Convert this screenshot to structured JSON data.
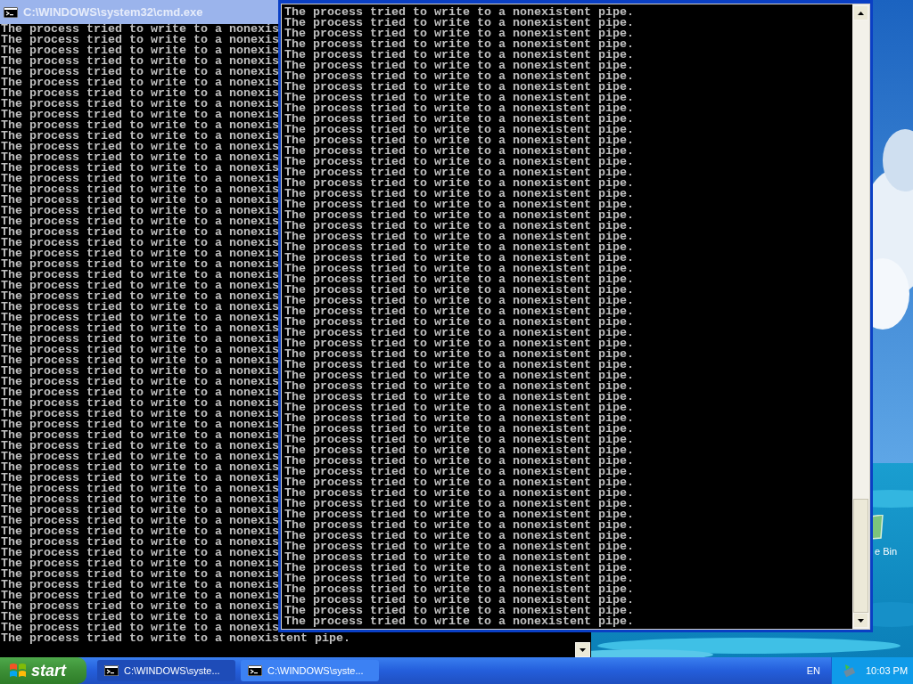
{
  "back_window": {
    "title": "C:\\WINDOWS\\system32\\cmd.exe",
    "lines": [
      "The process tried to write to a nonexis",
      "The process tried to write to a nonexis",
      "The process tried to write to a nonexis",
      "The process tried to write to a nonexis",
      "The process tried to write to a nonexis",
      "The process tried to write to a nonexis",
      "The process tried to write to a nonexis",
      "The process tried to write to a nonexis",
      "The process tried to write to a nonexis",
      "The process tried to write to a nonexis",
      "The process tried to write to a nonexis",
      "The process tried to write to a nonexis",
      "The process tried to write to a nonexis",
      "The process tried to write to a nonexis",
      "The process tried to write to a nonexis",
      "The process tried to write to a nonexis",
      "The process tried to write to a nonexis",
      "The process tried to write to a nonexis",
      "The process tried to write to a nonexis",
      "The process tried to write to a nonexis",
      "The process tried to write to a nonexis",
      "The process tried to write to a nonexis",
      "The process tried to write to a nonexis",
      "The process tried to write to a nonexis",
      "The process tried to write to a nonexis",
      "The process tried to write to a nonexis",
      "The process tried to write to a nonexis",
      "The process tried to write to a nonexis",
      "The process tried to write to a nonexis",
      "The process tried to write to a nonexis",
      "The process tried to write to a nonexis",
      "The process tried to write to a nonexis",
      "The process tried to write to a nonexis",
      "The process tried to write to a nonexis",
      "The process tried to write to a nonexis",
      "The process tried to write to a nonexis",
      "The process tried to write to a nonexis",
      "The process tried to write to a nonexis",
      "The process tried to write to a nonexis",
      "The process tried to write to a nonexis",
      "The process tried to write to a nonexis",
      "The process tried to write to a nonexis",
      "The process tried to write to a nonexis",
      "The process tried to write to a nonexis",
      "The process tried to write to a nonexis",
      "The process tried to write to a nonexis",
      "The process tried to write to a nonexis",
      "The process tried to write to a nonexis",
      "The process tried to write to a nonexis",
      "The process tried to write to a nonexis",
      "The process tried to write to a nonexis",
      "The process tried to write to a nonexis",
      "The process tried to write to a nonexis",
      "The process tried to write to a nonexis",
      "The process tried to write to a nonexis",
      "The process tried to write to a nonexis",
      "The process tried to write to a nonexis",
      "The process tried to write to a nonexistent pipe."
    ]
  },
  "front_window": {
    "lines": [
      "The process tried to write to a nonexistent pipe.",
      "The process tried to write to a nonexistent pipe.",
      "The process tried to write to a nonexistent pipe.",
      "The process tried to write to a nonexistent pipe.",
      "The process tried to write to a nonexistent pipe.",
      "The process tried to write to a nonexistent pipe.",
      "The process tried to write to a nonexistent pipe.",
      "The process tried to write to a nonexistent pipe.",
      "The process tried to write to a nonexistent pipe.",
      "The process tried to write to a nonexistent pipe.",
      "The process tried to write to a nonexistent pipe.",
      "The process tried to write to a nonexistent pipe.",
      "The process tried to write to a nonexistent pipe.",
      "The process tried to write to a nonexistent pipe.",
      "The process tried to write to a nonexistent pipe.",
      "The process tried to write to a nonexistent pipe.",
      "The process tried to write to a nonexistent pipe.",
      "The process tried to write to a nonexistent pipe.",
      "The process tried to write to a nonexistent pipe.",
      "The process tried to write to a nonexistent pipe.",
      "The process tried to write to a nonexistent pipe.",
      "The process tried to write to a nonexistent pipe.",
      "The process tried to write to a nonexistent pipe.",
      "The process tried to write to a nonexistent pipe.",
      "The process tried to write to a nonexistent pipe.",
      "The process tried to write to a nonexistent pipe.",
      "The process tried to write to a nonexistent pipe.",
      "The process tried to write to a nonexistent pipe.",
      "The process tried to write to a nonexistent pipe.",
      "The process tried to write to a nonexistent pipe.",
      "The process tried to write to a nonexistent pipe.",
      "The process tried to write to a nonexistent pipe.",
      "The process tried to write to a nonexistent pipe.",
      "The process tried to write to a nonexistent pipe.",
      "The process tried to write to a nonexistent pipe.",
      "The process tried to write to a nonexistent pipe.",
      "The process tried to write to a nonexistent pipe.",
      "The process tried to write to a nonexistent pipe.",
      "The process tried to write to a nonexistent pipe.",
      "The process tried to write to a nonexistent pipe.",
      "The process tried to write to a nonexistent pipe.",
      "The process tried to write to a nonexistent pipe.",
      "The process tried to write to a nonexistent pipe.",
      "The process tried to write to a nonexistent pipe.",
      "The process tried to write to a nonexistent pipe.",
      "The process tried to write to a nonexistent pipe.",
      "The process tried to write to a nonexistent pipe.",
      "The process tried to write to a nonexistent pipe.",
      "The process tried to write to a nonexistent pipe.",
      "The process tried to write to a nonexistent pipe.",
      "The process tried to write to a nonexistent pipe.",
      "The process tried to write to a nonexistent pipe.",
      "The process tried to write to a nonexistent pipe.",
      "The process tried to write to a nonexistent pipe.",
      "The process tried to write to a nonexistent pipe.",
      "The process tried to write to a nonexistent pipe.",
      "The process tried to write to a nonexistent pipe.",
      "The process tried to write to a nonexistent pipe."
    ]
  },
  "desktop": {
    "icon_label": "e Bin"
  },
  "taskbar": {
    "start": "start",
    "buttons": [
      {
        "label": "C:\\WINDOWS\\syste...",
        "selected": true
      },
      {
        "label": "C:\\WINDOWS\\syste...",
        "selected": false
      }
    ],
    "language": "EN",
    "clock": "10:03 PM"
  }
}
